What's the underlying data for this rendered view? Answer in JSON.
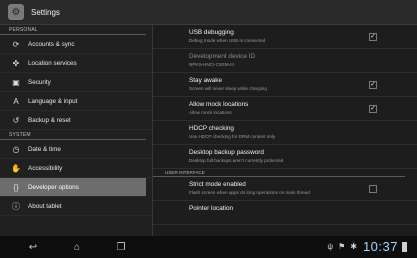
{
  "titlebar": {
    "title": "Settings",
    "icon": "settings-icon"
  },
  "sidebar": {
    "personal_header": "PERSONAL",
    "system_header": "SYSTEM",
    "items": [
      {
        "label": "Accounts & sync",
        "icon": "sync-icon"
      },
      {
        "label": "Location services",
        "icon": "location-icon"
      },
      {
        "label": "Security",
        "icon": "lock-icon"
      },
      {
        "label": "Language & input",
        "icon": "keyboard-icon"
      },
      {
        "label": "Backup & reset",
        "icon": "backup-icon"
      },
      {
        "label": "Date & time",
        "icon": "clock-icon"
      },
      {
        "label": "Accessibility",
        "icon": "hand-icon"
      },
      {
        "label": "Developer options",
        "icon": "braces-icon",
        "selected": true
      },
      {
        "label": "About tablet",
        "icon": "info-icon"
      }
    ]
  },
  "content": {
    "rows": [
      {
        "title": "USB debugging",
        "summary": "Debug mode when USB is connected",
        "checked": true
      },
      {
        "title": "Development device ID",
        "summary": "NPKS-HNCI-C8SM-III",
        "dim": true
      },
      {
        "title": "Stay awake",
        "summary": "Screen will never sleep while charging",
        "checked": true
      },
      {
        "title": "Allow mock locations",
        "summary": "Allow mock locations",
        "checked": true
      },
      {
        "title": "HDCP checking",
        "summary": "Use HDCP checking for DRM content only"
      },
      {
        "title": "Desktop backup password",
        "summary": "Desktop full backups aren't currently protected"
      },
      {
        "title": "Strict mode enabled",
        "summary": "Flash screen when apps do long operations on main thread",
        "checked": false
      },
      {
        "title": "Pointer location",
        "summary": ""
      }
    ],
    "ui_header": "USER INTERFACE"
  },
  "navbar": {
    "back": "back-icon",
    "home": "home-icon",
    "recents": "recents-icon"
  },
  "status": {
    "clock": "10:37"
  },
  "colors": {
    "selected": "#6d6d6d",
    "clock": "#9fd5ff"
  }
}
